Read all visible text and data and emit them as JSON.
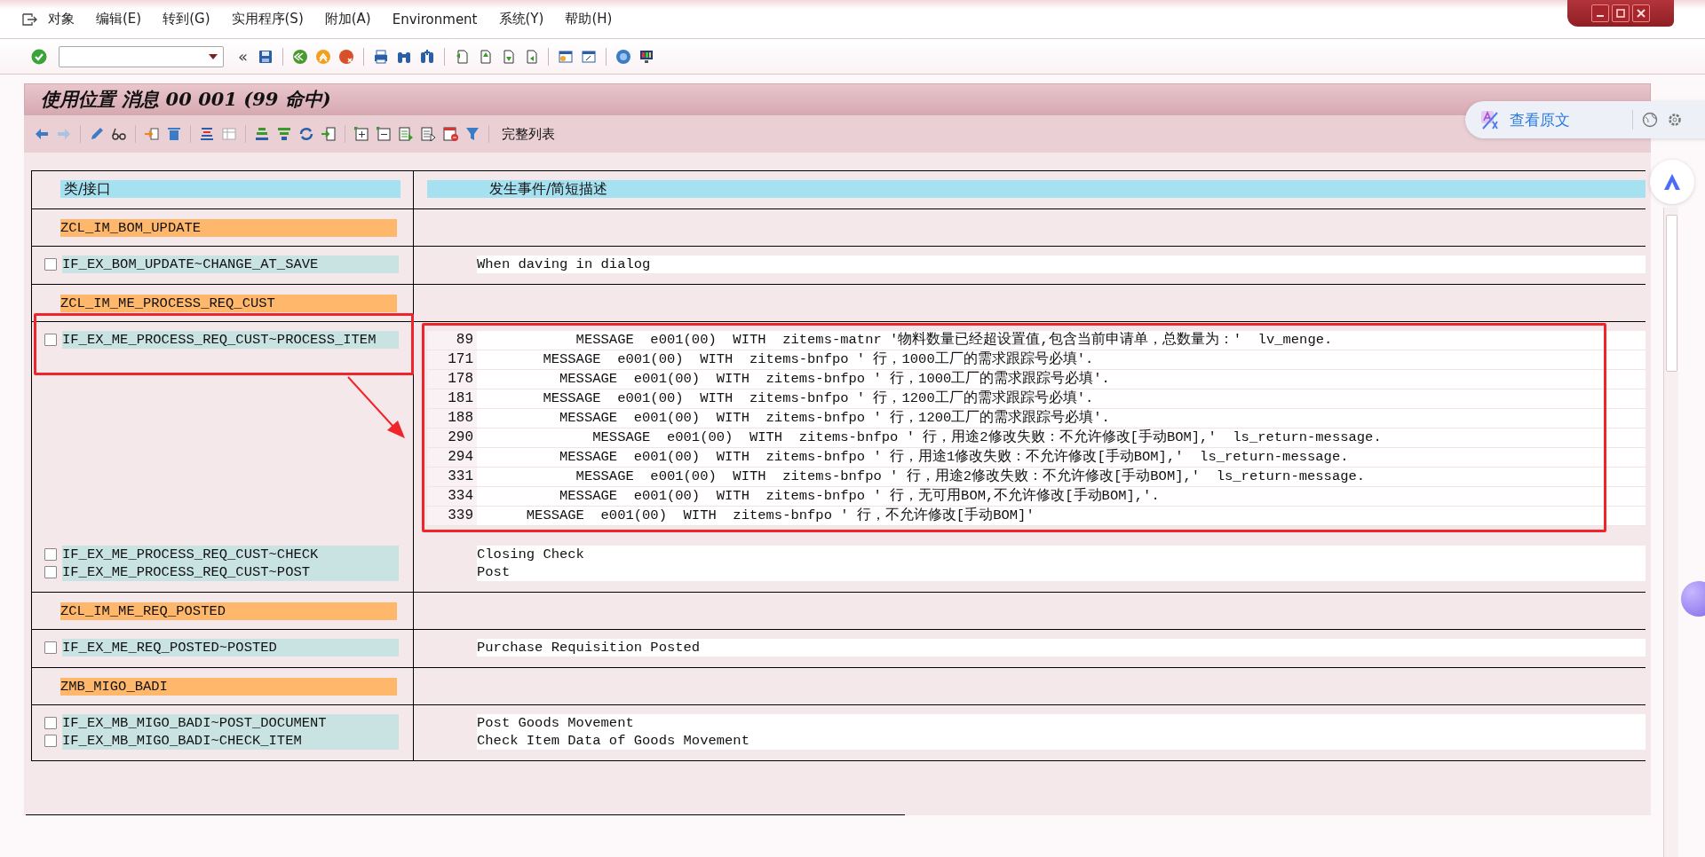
{
  "menu": [
    {
      "label": "对象"
    },
    {
      "label": "编辑(E)"
    },
    {
      "label": "转到(G)"
    },
    {
      "label": "实用程序(S)"
    },
    {
      "label": "附加(A)"
    },
    {
      "label": "Environment"
    },
    {
      "label": "系统(Y)"
    },
    {
      "label": "帮助(H)"
    }
  ],
  "toolbar": {
    "collapse_glyph": "«"
  },
  "title": "使用位置 消息 00 001 (99 命中)",
  "app_toolbar": {
    "full_list_button": "完整列表"
  },
  "translate_widget": {
    "label": "查看原文"
  },
  "table": {
    "columns": [
      "类/接口",
      "发生事件/简短描述"
    ],
    "sections": [
      {
        "kind": "class",
        "name": "ZCL_IM_BOM_UPDATE"
      },
      {
        "kind": "methods",
        "methods": [
          {
            "name": "IF_EX_BOM_UPDATE~CHANGE_AT_SAVE",
            "checked": false,
            "description": "When daving in dialog"
          }
        ]
      },
      {
        "kind": "class",
        "name": "ZCL_IM_ME_PROCESS_REQ_CUST"
      },
      {
        "kind": "methods",
        "methods": [
          {
            "name": "IF_EX_ME_PROCESS_REQ_CUST~PROCESS_ITEM",
            "checked": false,
            "code_lines": [
              {
                "line": "89",
                "code": "            MESSAGE  e001(00)  WITH  zitems-matnr '物料数量已经超设置值,包含当前申请单，总数量为：'  lv_menge."
              },
              {
                "line": "171",
                "code": "        MESSAGE  e001(00)  WITH  zitems-bnfpo ' 行，1000工厂的需求跟踪号必填'."
              },
              {
                "line": "178",
                "code": "          MESSAGE  e001(00)  WITH  zitems-bnfpo ' 行，1000工厂的需求跟踪号必填'."
              },
              {
                "line": "181",
                "code": "        MESSAGE  e001(00)  WITH  zitems-bnfpo ' 行，1200工厂的需求跟踪号必填'."
              },
              {
                "line": "188",
                "code": "          MESSAGE  e001(00)  WITH  zitems-bnfpo ' 行，1200工厂的需求跟踪号必填'."
              },
              {
                "line": "290",
                "code": "              MESSAGE  e001(00)  WITH  zitems-bnfpo ' 行，用途2修改失败：不允许修改[手动BOM],'  ls_return-message."
              },
              {
                "line": "294",
                "code": "          MESSAGE  e001(00)  WITH  zitems-bnfpo ' 行，用途1修改失败：不允许修改[手动BOM],'  ls_return-message."
              },
              {
                "line": "331",
                "code": "            MESSAGE  e001(00)  WITH  zitems-bnfpo ' 行，用途2修改失败：不允许修改[手动BOM],'  ls_return-message."
              },
              {
                "line": "334",
                "code": "          MESSAGE  e001(00)  WITH  zitems-bnfpo ' 行，无可用BOM,不允许修改[手动BOM],'."
              },
              {
                "line": "339",
                "code": "      MESSAGE  e001(00)  WITH  zitems-bnfpo ' 行，不允许修改[手动BOM]'"
              }
            ]
          },
          {
            "name": "IF_EX_ME_PROCESS_REQ_CUST~CHECK",
            "checked": false,
            "description": "Closing Check"
          },
          {
            "name": "IF_EX_ME_PROCESS_REQ_CUST~POST",
            "checked": false,
            "description": "Post"
          }
        ]
      },
      {
        "kind": "class",
        "name": "ZCL_IM_ME_REQ_POSTED"
      },
      {
        "kind": "methods",
        "methods": [
          {
            "name": "IF_EX_ME_REQ_POSTED~POSTED",
            "checked": false,
            "description": "Purchase Requisition Posted"
          }
        ]
      },
      {
        "kind": "class",
        "name": "ZMB_MIGO_BADI"
      },
      {
        "kind": "methods",
        "methods": [
          {
            "name": "IF_EX_MB_MIGO_BADI~POST_DOCUMENT",
            "checked": false,
            "description": "Post Goods Movement"
          },
          {
            "name": "IF_EX_MB_MIGO_BADI~CHECK_ITEM",
            "checked": false,
            "description": "Check Item Data of Goods Movement"
          }
        ]
      }
    ]
  }
}
